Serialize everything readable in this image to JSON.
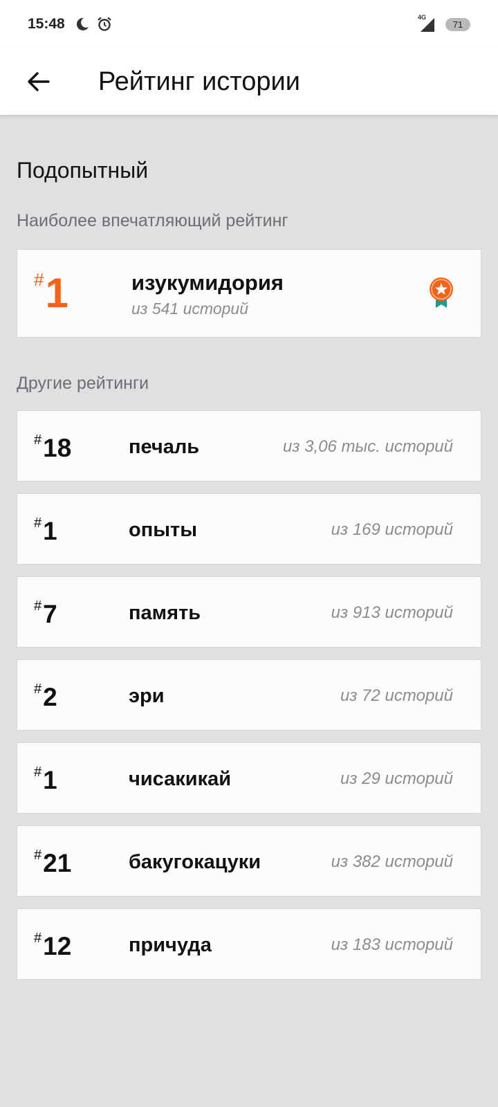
{
  "status_bar": {
    "time": "15:48",
    "network": "4G",
    "battery": "71",
    "icons": [
      "moon-icon",
      "alarm-icon",
      "signal-icon",
      "battery-icon"
    ]
  },
  "app_bar": {
    "back_icon": "arrow-left-icon",
    "title": "Рейтинг истории"
  },
  "story": {
    "title": "Подопытный"
  },
  "best": {
    "label": "Наиболее впечатляющий рейтинг",
    "hash": "#",
    "rank": "1",
    "tag": "изукумидория",
    "of": "из 541 историй",
    "icon": "award-medal-icon",
    "accent": "#f26419",
    "ribbon": "#1f9a93"
  },
  "others": {
    "label": "Другие рейтинги",
    "items": [
      {
        "hash": "#",
        "rank": "18",
        "tag": "печаль",
        "of": "из 3,06 тыс. историй"
      },
      {
        "hash": "#",
        "rank": "1",
        "tag": "опыты",
        "of": "из 169 историй"
      },
      {
        "hash": "#",
        "rank": "7",
        "tag": "память",
        "of": "из 913 историй"
      },
      {
        "hash": "#",
        "rank": "2",
        "tag": "эри",
        "of": "из 72 историй"
      },
      {
        "hash": "#",
        "rank": "1",
        "tag": "чисакикай",
        "of": "из 29 историй"
      },
      {
        "hash": "#",
        "rank": "21",
        "tag": "бакугокацуки",
        "of": "из 382 историй"
      },
      {
        "hash": "#",
        "rank": "12",
        "tag": "причуда",
        "of": "из 183 историй"
      }
    ]
  }
}
